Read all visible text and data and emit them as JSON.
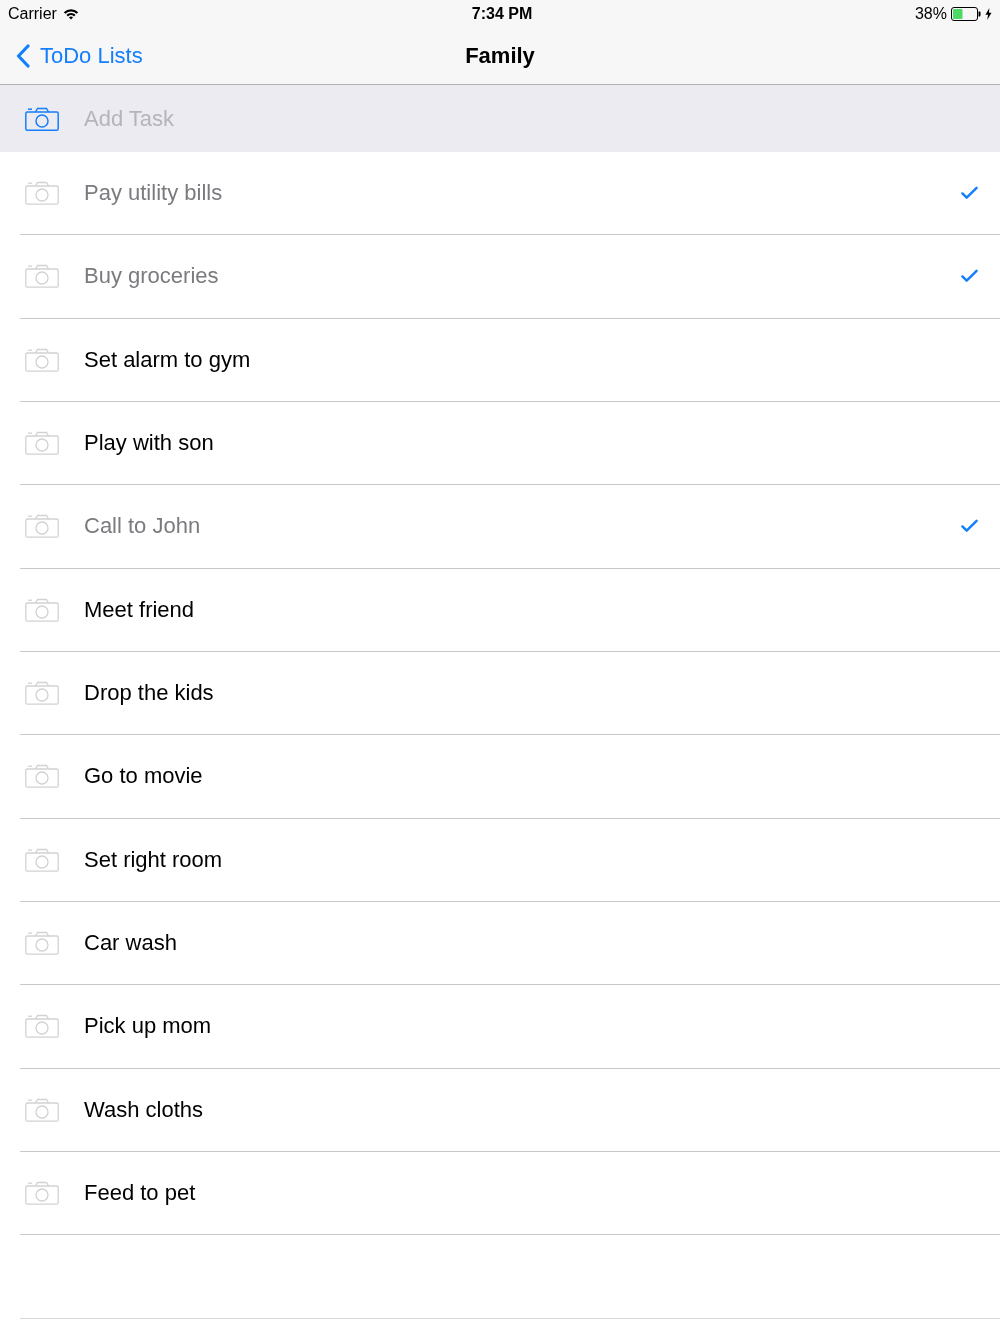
{
  "status_bar": {
    "carrier": "Carrier",
    "time": "7:34 PM",
    "battery": "38%"
  },
  "nav_bar": {
    "back": "ToDo Lists",
    "title": "Family"
  },
  "add_task": {
    "placeholder": "Add Task"
  },
  "tasks": [
    {
      "title": "Pay utility bills",
      "checked": true
    },
    {
      "title": "Buy groceries",
      "checked": true
    },
    {
      "title": "Set alarm to gym",
      "checked": false
    },
    {
      "title": "Play with son",
      "checked": false
    },
    {
      "title": "Call to John",
      "checked": true
    },
    {
      "title": "Meet friend",
      "checked": false
    },
    {
      "title": "Drop the kids",
      "checked": false
    },
    {
      "title": "Go to movie",
      "checked": false
    },
    {
      "title": "Set right room",
      "checked": false
    },
    {
      "title": "Car wash",
      "checked": false
    },
    {
      "title": "Pick up mom",
      "checked": false
    },
    {
      "title": "Wash cloths",
      "checked": false
    },
    {
      "title": "Feed to pet",
      "checked": false
    }
  ]
}
